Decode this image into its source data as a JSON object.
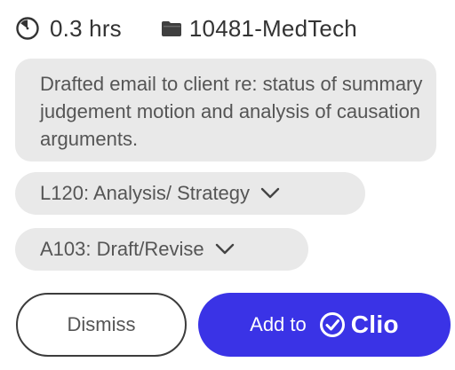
{
  "time_entry": {
    "hours": "0.3 hrs",
    "matter": "10481-MedTech",
    "description": "Drafted email to client re: status of summary judgement motion and analysis of causation arguments.",
    "activity_code": "L120: Analysis/ Strategy",
    "task_code": "A103: Draft/Revise"
  },
  "actions": {
    "dismiss_label": "Dismiss",
    "add_label": "Add to",
    "brand": "Clio"
  },
  "icons": {
    "hours": "clock-icon",
    "matter": "folder-icon",
    "dropdown": "chevron-down-icon",
    "brand": "check-circle-icon"
  },
  "colors": {
    "accent": "#3a33e6",
    "pill_background": "#e9e9e9",
    "text": "#555555"
  }
}
